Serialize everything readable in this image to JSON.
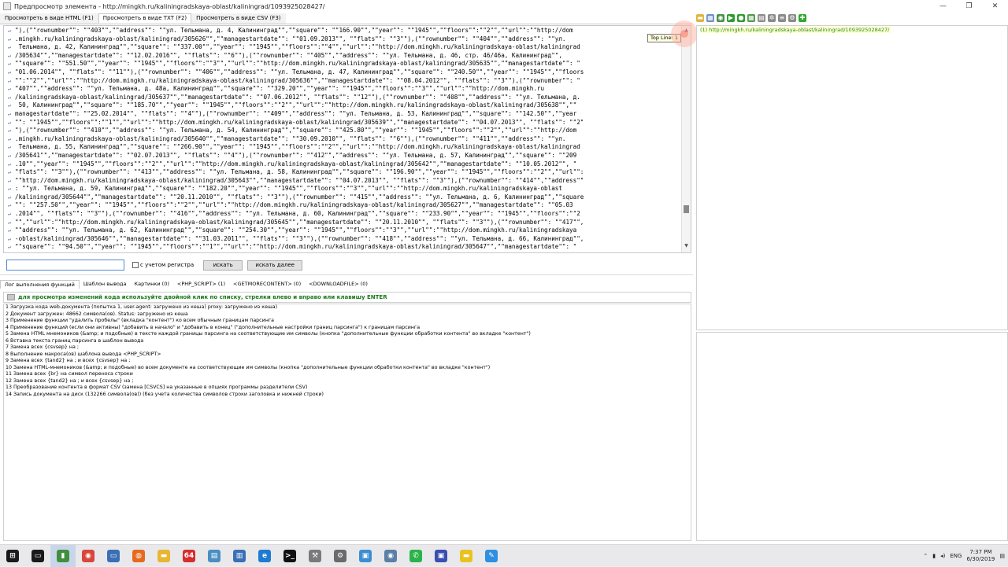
{
  "window": {
    "title": "Предпросмотр элемента - http://mingkh.ru/kaliningradskaya-oblast/kaliningrad/1093925028427/",
    "controls": [
      "—",
      "❐",
      "✕"
    ]
  },
  "tabs": [
    {
      "label": "Просмотреть в виде HTML (F1)",
      "active": false
    },
    {
      "label": "Просмотреть в виде TXT (F2)",
      "active": true
    },
    {
      "label": "Просмотреть в виде CSV (F3)",
      "active": false
    }
  ],
  "toolbar_icons": [
    {
      "name": "folder-icon",
      "color": "#e3b341",
      "glyph": "▬"
    },
    {
      "name": "table-icon",
      "color": "#6b8fc7",
      "glyph": "▦"
    },
    {
      "name": "zoom-icon",
      "color": "#4b8f4b",
      "glyph": "◉"
    },
    {
      "name": "forward-icon",
      "color": "#2e9b2e",
      "glyph": "▶"
    },
    {
      "name": "globe-icon",
      "color": "#2e9b2e",
      "glyph": "●"
    },
    {
      "name": "grid-icon",
      "color": "#4e9a4e",
      "glyph": "▦"
    },
    {
      "name": "page-icon",
      "color": "#8a8a8a",
      "glyph": "▤"
    },
    {
      "name": "settings-icon",
      "color": "#8a8a8a",
      "glyph": "✲"
    },
    {
      "name": "list-icon",
      "color": "#8a8a8a",
      "glyph": "≡"
    },
    {
      "name": "tools-icon",
      "color": "#8a8a8a",
      "glyph": "⚙"
    },
    {
      "name": "add-icon",
      "color": "#2eaa2e",
      "glyph": "✚"
    }
  ],
  "code_lines": [
    "\"),(\"\"rownumber\"\": \"\"403\"\",\"\"address\"\": \"\"ул. Тельмана, д. 4, Калининград\"\",\"\"square\"\": \"\"166.90\"\",\"\"year\"\": \"\"1945\"\",\"\"floors\"\":\"\"2\"\",\"\"url\"\":\"\"http://dom",
    ".mingkh.ru/kaliningradskaya-oblast/kaliningrad/305626\"\",\"\"managestartdate\"\": \"\"01.09.2013\"\", \"\"flats\"\": \"\"3\"\"),(\"\"rownumber\"\": \"\"404\"\",\"\"address\"\": \"\"ул.",
    " Тельмана, д. 42, Калининград\"\",\"\"square\"\": \"\"337.00\"\",\"\"year\"\": \"\"1945\"\",\"\"floors\"\":\"\"4\"\",\"\"url\"\":\"\"http://dom.mingkh.ru/kaliningradskaya-oblast/kaliningrad",
    "/305634\"\",\"\"managestartdate\"\": \"\"12.02.2016\"\", \"\"flats\"\": \"\"6\"\"),(\"\"rownumber\"\": \"\"405\"\",\"\"address\"\": \"\"ул. Тельмана, д. 46, стр. 46/46а, Калининград\"\",",
    "\"\"square\"\": \"\"551.50\"\",\"\"year\"\": \"\"1945\"\",\"\"floors\"\":\"\"3\"\",\"\"url\"\":\"\"http://dom.mingkh.ru/kaliningradskaya-oblast/kaliningrad/305635\"\",\"\"managestartdate\"\": \"",
    "\"01.06.2014\"\", \"\"flats\"\": \"\"11\"\"),(\"\"rownumber\"\": \"\"406\"\",\"\"address\"\": \"\"ул. Тельмана, д. 47, Калининград\"\",\"\"square\"\": \"\"240.50\"\",\"\"year\"\": \"\"1945\"\",\"\"floors",
    "\"\":\"\"2\"\",\"\"url\"\":\"\"http://dom.mingkh.ru/kaliningradskaya-oblast/kaliningrad/305636\"\",\"\"managestartdate\"\": \"\"08.04.2012\"\", \"\"flats\"\": \"\"3\"\"),(\"\"rownumber\"\": \"",
    "\"407\"\",\"\"address\"\": \"\"ул. Тельмана, д. 48а, Калининград\"\",\"\"square\"\": \"\"329.20\"\",\"\"year\"\": \"\"1945\"\",\"\"floors\"\":\"\"3\"\",\"\"url\"\":\"\"http://dom.mingkh.ru",
    "/kaliningradskaya-oblast/kaliningrad/305637\"\",\"\"managestartdate\"\": \"\"07.06.2012\"\", \"\"flats\"\": \"\"12\"\"),(\"\"rownumber\"\": \"\"408\"\",\"\"address\"\": \"\"ул. Тельмана, д.",
    " 50, Калининград\"\",\"\"square\"\": \"\"185.70\"\",\"\"year\"\": \"\"1945\"\",\"\"floors\"\":\"\"2\"\",\"\"url\"\":\"\"http://dom.mingkh.ru/kaliningradskaya-oblast/kaliningrad/305638\"\",\"\"",
    "managestartdate\"\": \"\"25.02.2014\"\", \"\"flats\"\": \"\"4\"\"),(\"\"rownumber\"\": \"\"409\"\",\"\"address\"\": \"\"ул. Тельмана, д. 53, Калининград\"\",\"\"square\"\": \"\"142.50\"\",\"\"year",
    "\"\": \"\"1945\"\",\"\"floors\"\":\"\"1\"\",\"\"url\"\":\"\"http://dom.mingkh.ru/kaliningradskaya-oblast/kaliningrad/305639\"\",\"\"managestartdate\"\": \"\"04.07.2013\"\", \"\"flats\"\": \"\"2\"",
    "\"),(\"\"rownumber\"\": \"\"410\"\",\"\"address\"\": \"\"ул. Тельмана, д. 54, Калининград\"\",\"\"square\"\": \"\"425.80\"\",\"\"year\"\": \"\"1945\"\",\"\"floors\"\":\"\"2\"\",\"\"url\"\":\"\"http://dom",
    ".mingkh.ru/kaliningradskaya-oblast/kaliningrad/305640\"\",\"\"managestartdate\"\": \"\"30.09.2010\"\", \"\"flats\"\": \"\"6\"\"),(\"\"rownumber\"\": \"\"411\"\",\"\"address\"\": \"\"ул.",
    " Тельмана, д. 55, Калининград\"\",\"\"square\"\": \"\"266.90\"\",\"\"year\"\": \"\"1945\"\",\"\"floors\"\":\"\"2\"\",\"\"url\"\":\"\"http://dom.mingkh.ru/kaliningradskaya-oblast/kaliningrad",
    "/305641\"\",\"\"managestartdate\"\": \"\"02.07.2013\"\", \"\"flats\"\": \"\"4\"\"),(\"\"rownumber\"\": \"\"412\"\",\"\"address\"\": \"\"ул. Тельмана, д. 57, Калининград\"\",\"\"square\"\": \"\"209",
    ".10\"\",\"\"year\"\": \"\"1945\"\",\"\"floors\"\":\"\"2\"\",\"\"url\"\":\"\"http://dom.mingkh.ru/kaliningradskaya-oblast/kaliningrad/305642\"\",\"\"managestartdate\"\": \"\"10.05.2012\"\", \"",
    "\"flats\"\": \"\"3\"\"),(\"\"rownumber\"\": \"\"413\"\",\"\"address\"\": \"\"ул. Тельмана, д. 58, Калининград\"\",\"\"square\"\": \"\"196.90\"\",\"\"year\"\": \"\"1945\"\",\"\"floors\"\":\"\"2\"\",\"\"url\"\":",
    "\"\"http://dom.mingkh.ru/kaliningradskaya-oblast/kaliningrad/305643\"\",\"\"managestartdate\"\": \"\"04.07.2013\"\", \"\"flats\"\": \"\"3\"\"),(\"\"rownumber\"\": \"\"414\"\",\"\"address\"\"",
    ": \"\"ул. Тельмана, д. 59, Калининград\"\",\"\"square\"\": \"\"182.20\"\",\"\"year\"\": \"\"1945\"\",\"\"floors\"\":\"\"3\"\",\"\"url\"\":\"\"http://dom.mingkh.ru/kaliningradskaya-oblast",
    "/kaliningrad/305644\"\",\"\"managestartdate\"\": \"\"20.11.2010\"\", \"\"flats\"\": \"\"3\"\"),(\"\"rownumber\"\": \"\"415\"\",\"\"address\"\": \"\"ул. Тельмана, д. 6, Калининград\"\",\"\"square",
    "\"\": \"\"257.50\"\",\"\"year\"\": \"\"1945\"\",\"\"floors\"\":\"\"2\"\",\"\"url\"\":\"\"http://dom.mingkh.ru/kaliningradskaya-oblast/kaliningrad/305627\"\",\"\"managestartdate\"\": \"\"05.03",
    ".2014\"\", \"\"flats\"\": \"\"3\"\"),(\"\"rownumber\"\": \"\"416\"\",\"\"address\"\": \"\"ул. Тельмана, д. 60, Калининград\"\",\"\"square\"\": \"\"233.90\"\",\"\"year\"\": \"\"1945\"\",\"\"floors\"\":\"\"2",
    "\"\",\"\"url\"\":\"\"http://dom.mingkh.ru/kaliningradskaya-oblast/kaliningrad/305645\"\",\"\"managestartdate\"\": \"\"20.11.2010\"\", \"\"flats\"\": \"\"3\"\"),(\"\"rownumber\"\": \"\"417\"\",",
    "\"\"address\"\": \"\"ул. Тельмана, д. 62, Калининград\"\",\"\"square\"\": \"\"254.30\"\",\"\"year\"\": \"\"1945\"\",\"\"floors\"\":\"\"3\"\",\"\"url\"\":\"\"http://dom.mingkh.ru/kaliningradskaya",
    "-oblast/kaliningrad/305646\"\",\"\"managestartdate\"\": \"\"31.03.2011\"\", \"\"flats\"\": \"\"3\"\"),(\"\"rownumber\"\": \"\"418\"\",\"\"address\"\": \"\"ул. Тельмана, д. 66, Калининград\"\",",
    "\"\"square\"\": \"\"94.50\"\",\"\"year\"\": \"\"1945\"\",\"\"floors\"\":\"\"1\"\",\"\"url\"\":\"\"http://dom.mingkh.ru/kaliningradskaya-oblast/kaliningrad/305647\"\",\"\"managestartdate\"\": \""
  ],
  "tooltip": "Top Line: 1",
  "search": {
    "value": "",
    "placeholder": "",
    "match_case_label": "с учетом регистра",
    "find_label": "искать",
    "find_next_label": "искать далее"
  },
  "bottom_tabs": [
    {
      "label": "Лог выполнения функций",
      "active": true
    },
    {
      "label": "Шаблон вывода",
      "active": false
    },
    {
      "label": "Картинки (0)",
      "active": false
    },
    {
      "label": "<PHP_SCRIPT> (1)",
      "active": false
    },
    {
      "label": "<GETMORECONTENT> (0)",
      "active": false
    },
    {
      "label": "<DOWNLOADFILE> (0)",
      "active": false
    }
  ],
  "hint": "для просмотра изменений кода используйте двойной клик по списку, стрелки влево и вправо или клавишу ENTER",
  "log": [
    "1  Загрузка кода web-документа (попытка 1, user-agent: загружено из кеша) proxy: загружено из кеша)",
    "2  Документ загружен: 48662 символа(ов). Status: загружено из кеша",
    "3  Применение функции \"удалить пробелы\" (вкладка \"контент\") ко всем обычным границам парсинга",
    "4  Применение функций (если они активны) \"добавить в начало\" и \"добавить в конец\" (\"дополнительные настройки границ парсинга\") к границам парсинга",
    "5  Замена HTML мнемоников (&amp; и подобные) в тексте каждой границы парсинга на соответствующие им символы (кнопка \"дополнительные функции обработки контента\" во вкладке \"контент\")",
    "6  Вставка текста границ парсинга в шаблон вывода",
    "7  Замена всех {csvsep} на ;",
    "8  Выполнение макроса(ов) шаблона вывода <PHP_SCRIPT>",
    "9  Замена всех {tand2} на ; и всех {csvsep} на ;",
    "10 Замена HTML-мнемоников (&amp; и подобные) во всем документе на соответствующие им символы (кнопка \"дополнительные функции обработки контента\" во вкладке \"контент\")",
    "11 Замена всех {br} на символ переноса строки",
    "12 Замена всех {tand2} на ; и всех {csvsep} на ;",
    "13 Преобразование контента в формат CSV (замена [CSVCS] на указанные в опциях программы разделители CSV)",
    "14 Запись документа на диск (132266 символа(ов)) (без учета количества символов строки заголовка и нижней строки)"
  ],
  "url_list": [
    "(1)  http://mingkh.ru/kaliningradskaya-oblast/kaliningrad/1093925028427/"
  ],
  "taskbar": {
    "icons": [
      {
        "name": "start-icon",
        "color": "#1a1a1a",
        "glyph": "⊞",
        "active": false
      },
      {
        "name": "task-view-icon",
        "color": "#1a1a1a",
        "glyph": "▭",
        "active": false
      },
      {
        "name": "parser-app-icon",
        "color": "#3f8f3f",
        "glyph": "▮",
        "active": true
      },
      {
        "name": "chrome-icon",
        "color": "#d9463b",
        "glyph": "◉",
        "active": false
      },
      {
        "name": "storage-icon",
        "color": "#3b6fb6",
        "glyph": "▭",
        "active": false
      },
      {
        "name": "firefox-icon",
        "color": "#e66a1f",
        "glyph": "◍",
        "active": false
      },
      {
        "name": "explorer-icon",
        "color": "#e8b631",
        "glyph": "▬",
        "active": false
      },
      {
        "name": "app-64-icon",
        "color": "#d62d2d",
        "glyph": "64",
        "active": false
      },
      {
        "name": "notepad-icon",
        "color": "#4a8fc2",
        "glyph": "▤",
        "active": false
      },
      {
        "name": "document-icon",
        "color": "#3b6fb6",
        "glyph": "▥",
        "active": false
      },
      {
        "name": "edge-icon",
        "color": "#1f7bd1",
        "glyph": "e",
        "active": false
      },
      {
        "name": "terminal-icon",
        "color": "#111111",
        "glyph": ">_",
        "active": false
      },
      {
        "name": "tools-icon",
        "color": "#7a7a7a",
        "glyph": "⚒",
        "active": false
      },
      {
        "name": "settings-icon",
        "color": "#6a6a6a",
        "glyph": "⚙",
        "active": false
      },
      {
        "name": "screen-icon",
        "color": "#3b8fd1",
        "glyph": "▣",
        "active": false
      },
      {
        "name": "browser-icon",
        "color": "#5a7fa8",
        "glyph": "◉",
        "active": false
      },
      {
        "name": "whatsapp-icon",
        "color": "#2bb34a",
        "glyph": "✆",
        "active": false
      },
      {
        "name": "save-icon",
        "color": "#3b4fb0",
        "glyph": "▣",
        "active": false
      },
      {
        "name": "sticky-icon",
        "color": "#e8c21f",
        "glyph": "▬",
        "active": false
      },
      {
        "name": "feather-icon",
        "color": "#2f8fe0",
        "glyph": "✎",
        "active": false
      }
    ],
    "language": "ENG",
    "time": "7:37 PM",
    "date": "6/30/2019"
  }
}
